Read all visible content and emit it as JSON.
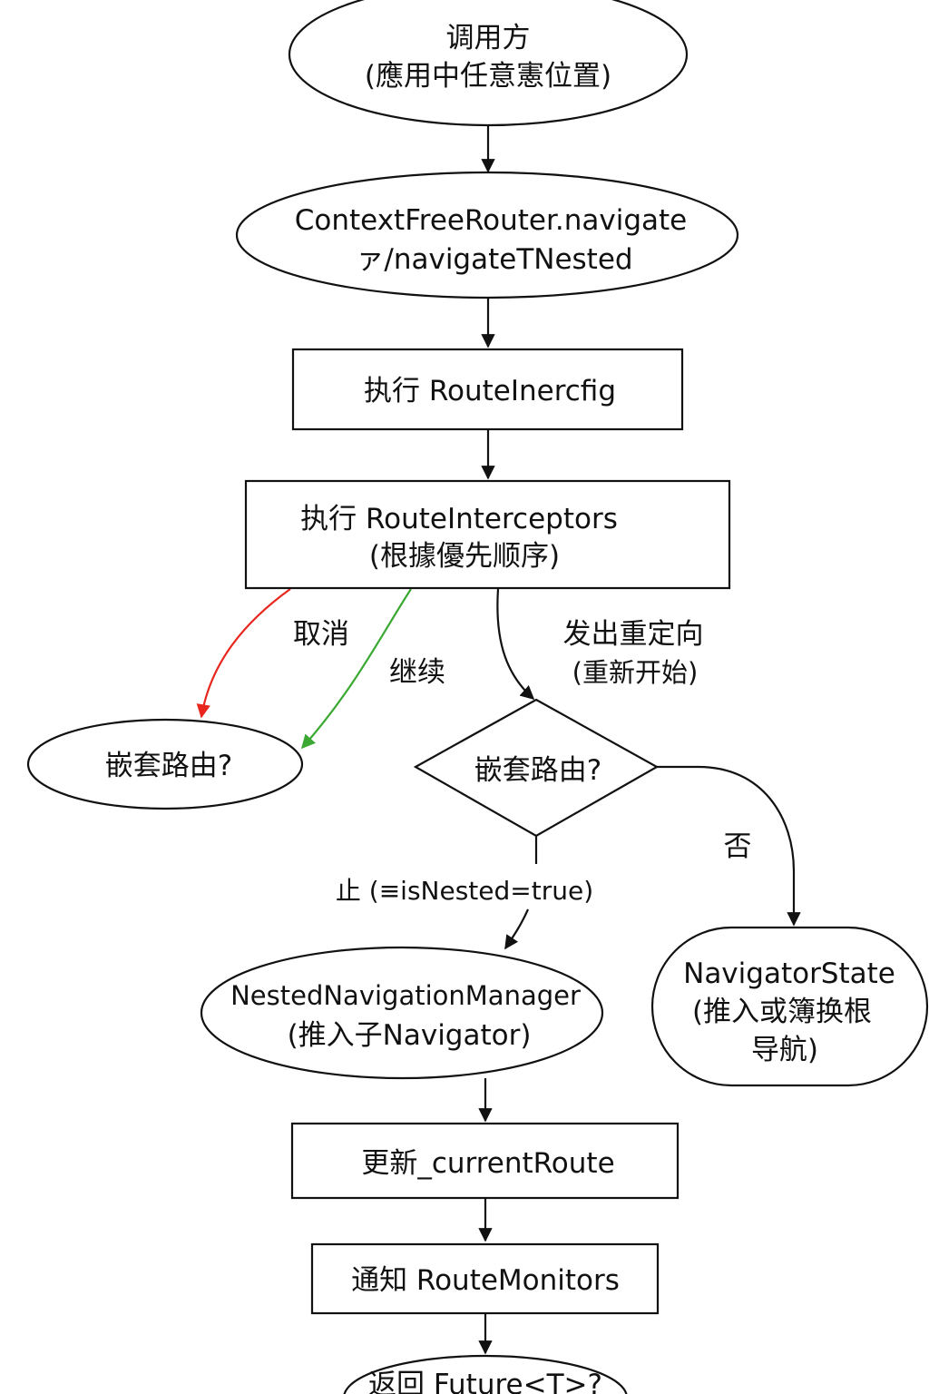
{
  "nodes": {
    "caller": {
      "line1": "调用方",
      "line2": "(應用中任意憲位置)"
    },
    "navigate": {
      "line1": "ContextFreeRouter.navigate",
      "line2": "ァ/navigateTNested"
    },
    "route_config": {
      "label": "执行 RouteInercfig"
    },
    "interceptors": {
      "line1": "执行 RouteInterceptors",
      "line2": "(根據優先顺序)"
    },
    "nested_left": {
      "label": "嵌套路由?"
    },
    "nested_decision": {
      "label": "嵌套路由?"
    },
    "nested_manager": {
      "line1": "NestedNavigationManager",
      "line2": "(推入子Navigator)"
    },
    "navigator_state": {
      "line1": "NavigatorState",
      "line2": "(推入或簿换根",
      "line3": "导航)"
    },
    "update_route": {
      "label": "更新_currentRoute"
    },
    "notify": {
      "label": "通知 RouteMonitors"
    },
    "return": {
      "label": "返回 Future<T>?"
    }
  },
  "edges": {
    "cancel": "取消",
    "continue": "继续",
    "redirect_line1": "发出重定向",
    "redirect_line2": "(重新开始)",
    "yes": "止 (≡isNested=true)",
    "no": "否"
  },
  "colors": {
    "cancel": "#e8261e",
    "continue": "#3aa832",
    "stroke": "#111111"
  }
}
